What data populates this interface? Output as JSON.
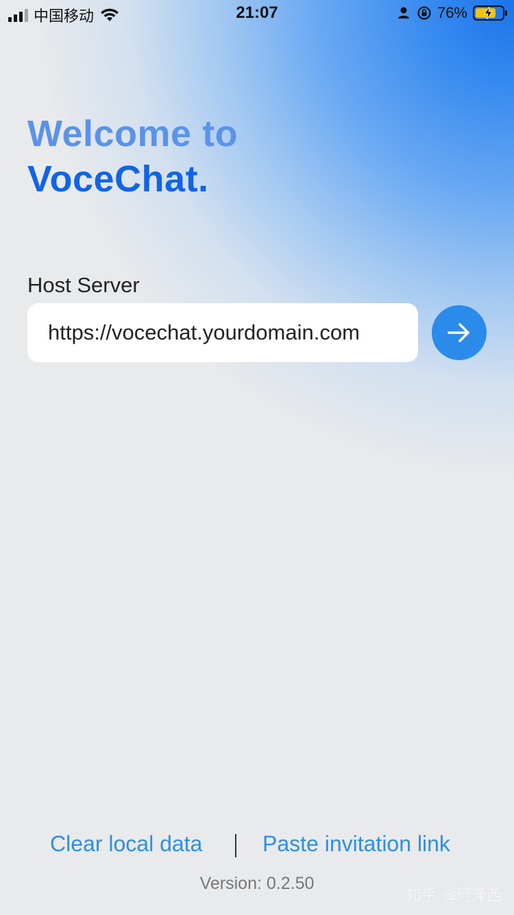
{
  "status_bar": {
    "carrier": "中国移动",
    "time": "21:07",
    "battery_percent": "76%",
    "battery_level": 0.76,
    "battery_color": "#f4c20d"
  },
  "welcome": {
    "line1": "Welcome to",
    "line2": "VoceChat."
  },
  "host": {
    "label": "Host Server",
    "value": "https://vocechat.yourdomain.com",
    "go_icon": "arrow-right-icon"
  },
  "footer": {
    "clear_label": "Clear local data",
    "divider": "|",
    "paste_label": "Paste invitation link",
    "version": "Version: 0.2.50"
  },
  "watermark": "知乎 @阿泽西",
  "colors": {
    "accent": "#2a8bea",
    "title_light": "#5a93e8",
    "title_dark": "#1164e4",
    "link": "#2f8fe0"
  }
}
